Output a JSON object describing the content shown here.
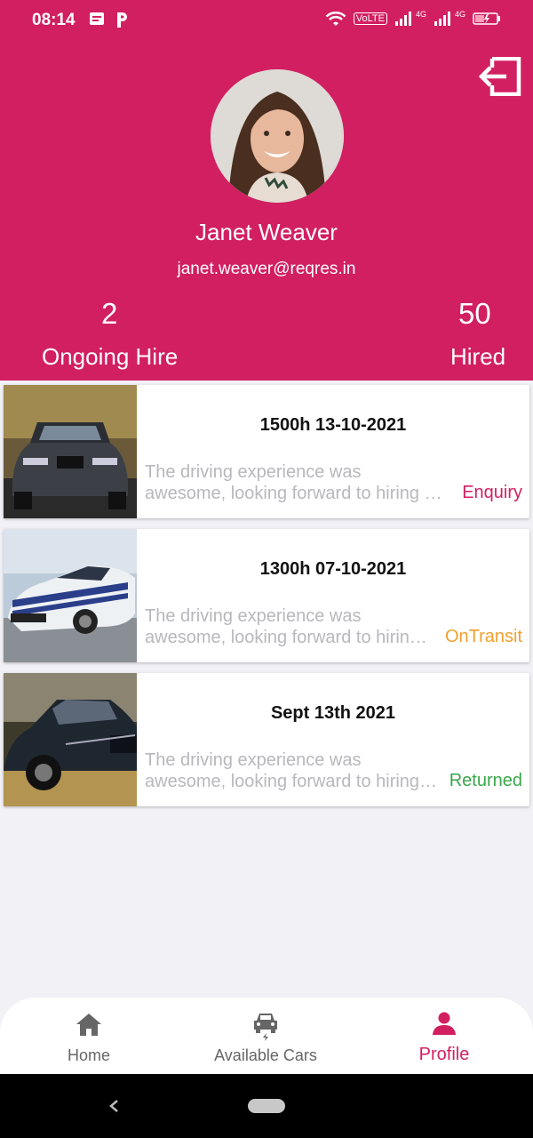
{
  "status_bar": {
    "time": "08:14",
    "volte": "VoLTE",
    "net1": "4G",
    "net2": "4G"
  },
  "profile": {
    "name": "Janet Weaver",
    "email": "janet.weaver@reqres.in",
    "ongoing_count": "2",
    "ongoing_label": "Ongoing Hire",
    "hired_count": "50",
    "hired_label": "Hired"
  },
  "hires": [
    {
      "date": "1500h 13-10-2021",
      "desc_line1": "The driving experience was",
      "desc_line2": "awesome, looking forward to hiring again",
      "status": "Enquiry",
      "status_color": "#d21f62"
    },
    {
      "date": "1300h 07-10-2021",
      "desc_line1": "The driving experience was",
      "desc_line2": "awesome, looking forward to hiring again",
      "status": "OnTransit",
      "status_color": "#f0a030"
    },
    {
      "date": "Sept 13th 2021",
      "desc_line1": "The driving experience was",
      "desc_line2": "awesome, looking forward to hiring again",
      "status": "Returned",
      "status_color": "#3aa64a"
    }
  ],
  "nav": {
    "home": "Home",
    "cars": "Available Cars",
    "profile": "Profile"
  },
  "colors": {
    "accent": "#d21f62",
    "background": "#f1f1f6"
  }
}
